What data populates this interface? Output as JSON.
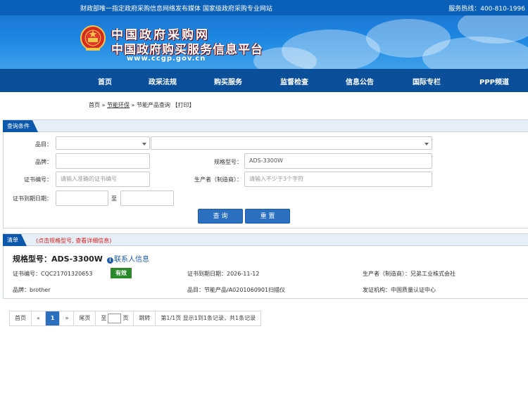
{
  "topbar": {
    "slogan": "财政部唯一指定政府采购信息网络发布媒体 国家级政府采购专业网站",
    "hotline": "服务热线：400-810-1996"
  },
  "banner": {
    "title_line1": "中国政府采购网",
    "title_line2": "中国政府购买服务信息平台",
    "url": "www.ccgp.gov.cn"
  },
  "nav": {
    "items": [
      "首页",
      "政采法规",
      "购买服务",
      "监督检查",
      "信息公告",
      "国际专栏",
      "PPP频道"
    ]
  },
  "breadcrumb": {
    "home": "首页",
    "sep1": " » ",
    "section": "节能环保",
    "sep2": " » ",
    "current": "节能产品查询",
    "print": "【打印】"
  },
  "query": {
    "header": "查询条件",
    "category_label": "品目：",
    "brand_label": "品牌：",
    "brand_value": "",
    "model_label": "规格型号：",
    "model_value": "ADS-3300W",
    "cert_label": "证书编号：",
    "cert_placeholder": "请输入准确的证书编号",
    "maker_label": "生产者（制造商）：",
    "maker_placeholder": "请输入不少于3个字符",
    "expiry_label": "证书到期日期：",
    "to_label": "至",
    "search_button": "查 询",
    "reset_button": "重 置"
  },
  "results": {
    "header": "清单",
    "hint": "(点击规格型号, 查看详细信息)",
    "item": {
      "title": "规格型号：ADS-3300W",
      "contact": "联系人信息",
      "cert_no": "证书编号：CQC21701320653",
      "status": "有效",
      "expiry": "证书到期日期：2026-11-12",
      "maker": "生产者（制造商）：兄弟工业株式会社",
      "brand": "品牌：brother",
      "category": "品目：节能产品/A0201060901扫描仪",
      "issuer": "发证机构：中国质量认证中心"
    }
  },
  "pager": {
    "first": "首页",
    "prev": "«",
    "current": "1",
    "next": "»",
    "last": "尾页",
    "goto_prefix": "至",
    "goto_suffix": "页",
    "jump": "跳转",
    "summary": "第1/1页 显示1到1条记录，共1条记录"
  },
  "colors": {
    "nav": "#0b4f9b",
    "accent": "#2a6fc0",
    "hint": "#d9201a",
    "valid_badge": "#2a8a2a"
  }
}
